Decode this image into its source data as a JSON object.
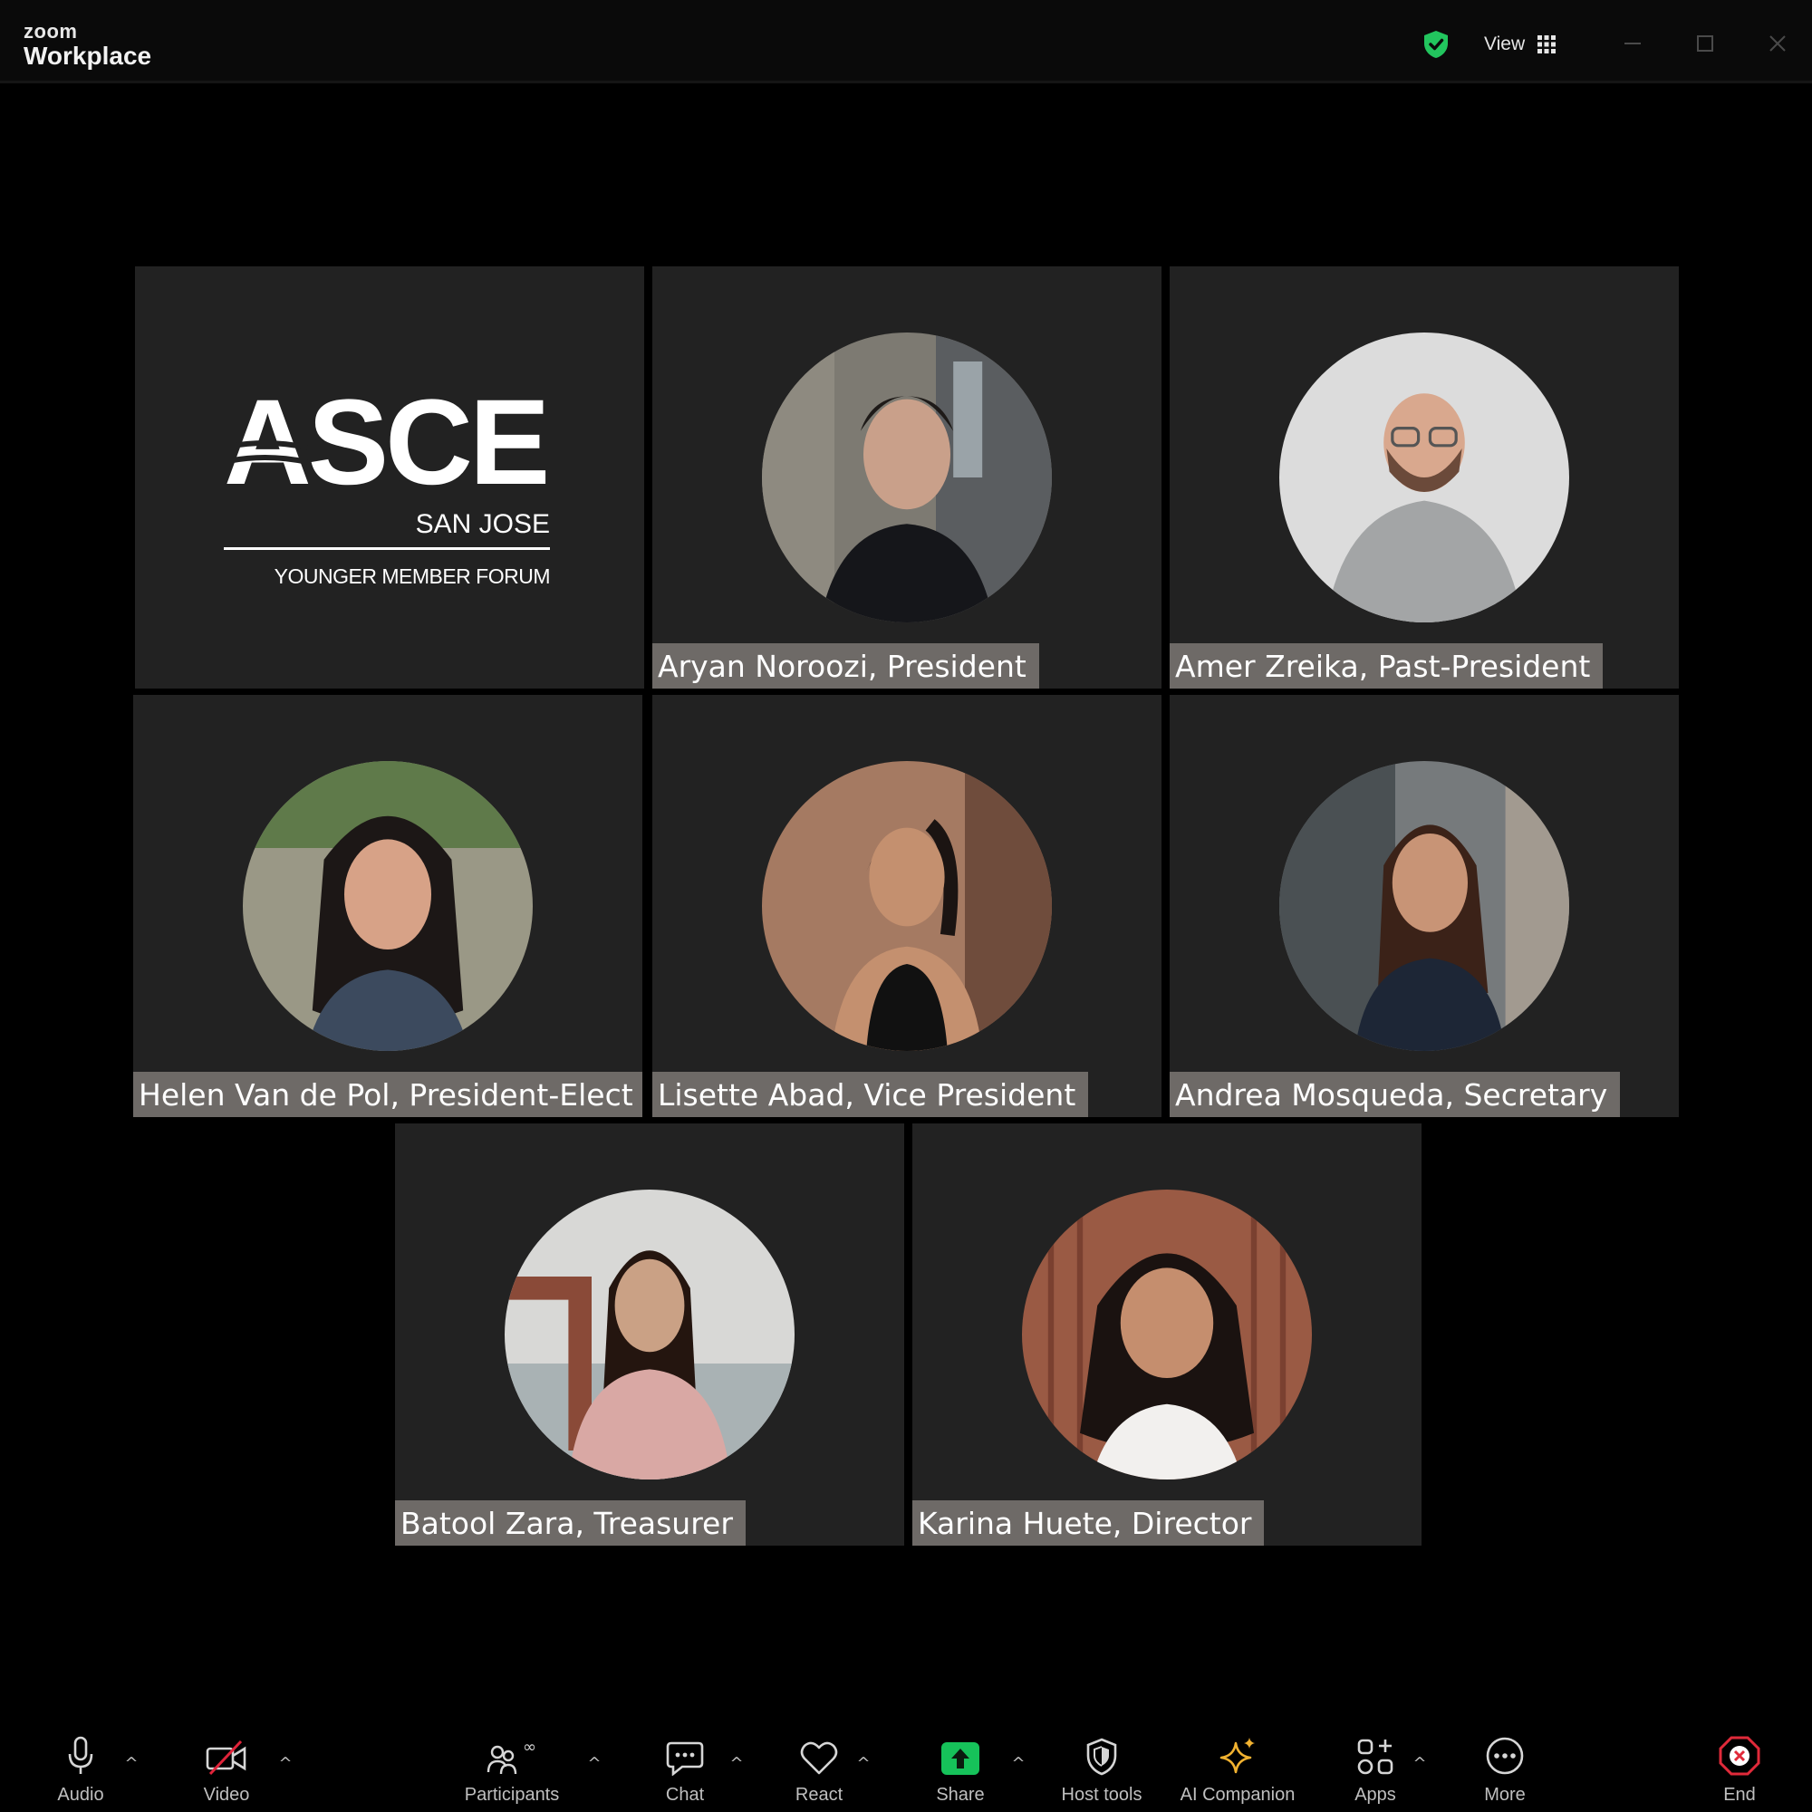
{
  "titlebar": {
    "brand_small": "zoom",
    "brand_large": "Workplace",
    "view_label": "View",
    "icons": [
      "encryption-shield-icon",
      "grid-icon",
      "minimize-icon",
      "maximize-icon",
      "close-icon"
    ],
    "shield_color": "#22c55e"
  },
  "logo_tile": {
    "org": "ASCE",
    "chapter": "SAN JOSE",
    "group": "YOUNGER MEMBER FORUM"
  },
  "participants": [
    {
      "name": "Aryan Noroozi, President"
    },
    {
      "name": "Amer Zreika, Past-President"
    },
    {
      "name": "Helen Van de Pol, President-Elect"
    },
    {
      "name": "Lisette Abad, Vice President"
    },
    {
      "name": "Andrea Mosqueda, Secretary"
    },
    {
      "name": "Batool Zara, Treasurer"
    },
    {
      "name": "Karina Huete, Director"
    }
  ],
  "toolbar": {
    "audio": "Audio",
    "video": "Video",
    "participants": "Participants",
    "chat": "Chat",
    "react": "React",
    "share": "Share",
    "host_tools": "Host tools",
    "ai_companion": "AI Companion",
    "apps": "Apps",
    "more": "More",
    "end": "End",
    "caret": "^",
    "share_color": "#16c25a",
    "end_color": "#e02a3a",
    "ai_color": "#f2b230"
  }
}
